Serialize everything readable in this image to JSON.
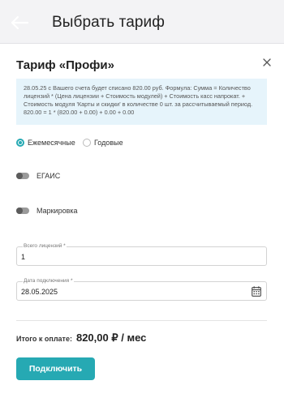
{
  "header": {
    "title": "Выбрать тариф",
    "back_icon": "arrow-left-icon"
  },
  "dialog": {
    "title": "Тариф «Профи»",
    "close_icon": "close-icon",
    "info_text": "28.05.25 с Вашего счета будет списано 820.00 руб. Формула: Сумма = Количество лицензий * (Цена лицензии + Стоимость модулей) + Стоимость касс напрокат. + Стоимость модуля 'Карты и скидки' в количестве 0 шт. за рассчитываемый период. 820.00 = 1 * (820.00 + 0.00) + 0.00 + 0.00",
    "billing": {
      "monthly_label": "Ежемесячные",
      "yearly_label": "Годовые",
      "selected": "monthly"
    },
    "modules": [
      {
        "label": "ЕГАИС",
        "enabled": false
      },
      {
        "label": "Маркировка",
        "enabled": false
      }
    ],
    "licenses": {
      "label": "Всего лицензий *",
      "value": "1"
    },
    "date": {
      "label": "Дата подключения *",
      "value": "28.05.2025",
      "icon": "calendar-icon"
    },
    "total": {
      "label": "Итого к оплате:",
      "value": "820,00 ₽ / мес"
    },
    "connect_button": "Подключить"
  },
  "colors": {
    "accent": "#26a9b3",
    "info_bg": "#e6f4fb",
    "appbar_bg": "#f3f3f5"
  }
}
